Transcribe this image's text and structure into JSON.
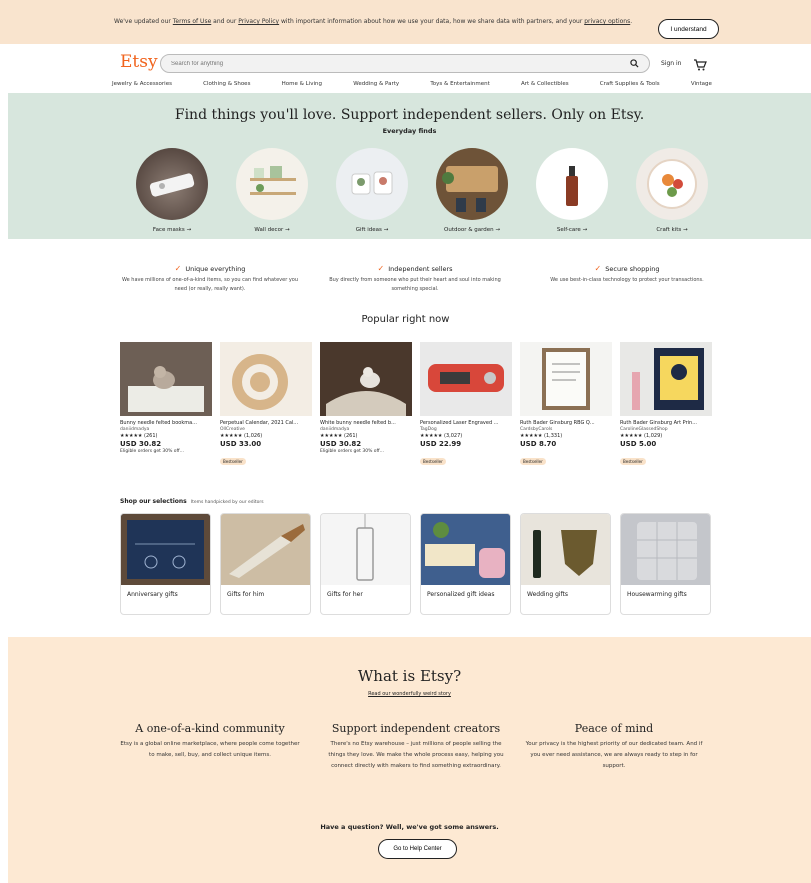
{
  "cookie": {
    "pre": "We've updated our ",
    "terms": "Terms of Use",
    "mid": " and our ",
    "privacy": "Privacy Policy",
    "post": " with important information about how we use your data, how we share data with partners, and your ",
    "options": "privacy options",
    "end": ".",
    "button": "I understand"
  },
  "header": {
    "logo": "Etsy",
    "search_placeholder": "Search for anything",
    "signin": "Sign in",
    "categories": [
      "Jewelry & Accessories",
      "Clothing & Shoes",
      "Home & Living",
      "Wedding & Party",
      "Toys & Entertainment",
      "Art & Collectibles",
      "Craft Supplies & Tools",
      "Vintage"
    ]
  },
  "hero": {
    "title": "Find things you'll love. Support independent sellers. Only on Etsy.",
    "subtitle": "Everyday finds",
    "items": [
      {
        "label": "Face masks →",
        "color": "#5a4b44"
      },
      {
        "label": "Wall decor →",
        "color": "#f4f1ea"
      },
      {
        "label": "Gift ideas →",
        "color": "#eceff2"
      },
      {
        "label": "Outdoor & garden →",
        "color": "#6e5338"
      },
      {
        "label": "Self-care →",
        "color": "#ffffff"
      },
      {
        "label": "Craft kits →",
        "color": "#f0ebe6"
      }
    ]
  },
  "props": [
    {
      "title": "Unique everything",
      "desc": "We have millions of one-of-a-kind items, so you can find whatever you need (or really, really want)."
    },
    {
      "title": "Independent sellers",
      "desc": "Buy directly from someone who put their heart and soul into making something special."
    },
    {
      "title": "Secure shopping",
      "desc": "We use best-in-class technology to protect your transactions."
    }
  ],
  "popular": {
    "title": "Popular right now",
    "items": [
      {
        "name": "Bunny needle felted bookma...",
        "shop": "daniidmadya",
        "rating": "★★★★★ (261)",
        "price": "USD 30.82",
        "note": "Eligible orders get 30% off...",
        "badge": ""
      },
      {
        "name": "Perpetual Calendar, 2021 Cal...",
        "shop": "OllCreative",
        "rating": "★★★★★ (1,026)",
        "price": "USD 33.00",
        "note": "",
        "badge": "Bestseller"
      },
      {
        "name": "White bunny needle felted b...",
        "shop": "daniidmadya",
        "rating": "★★★★★ (261)",
        "price": "USD 30.82",
        "note": "Eligible orders get 30% off...",
        "badge": ""
      },
      {
        "name": "Personalized Laser Engraved ...",
        "shop": "TagDog",
        "rating": "★★★★★ (3,027)",
        "price": "USD 22.99",
        "note": "",
        "badge": "Bestseller"
      },
      {
        "name": "Ruth Bader Ginsburg RBG Q...",
        "shop": "CardsbyCarols",
        "rating": "★★★★★ (1,331)",
        "price": "USD 8.70",
        "note": "",
        "badge": "Bestseller"
      },
      {
        "name": "Ruth Bader Ginsburg Art Prin...",
        "shop": "CarolineGlassedShop",
        "rating": "★★★★★ (1,029)",
        "price": "USD 5.00",
        "note": "",
        "badge": "Bestseller"
      }
    ]
  },
  "selections": {
    "title": "Shop our selections",
    "subtitle": "Items handpicked by our editors",
    "items": [
      {
        "label": "Anniversary gifts",
        "color": "#2a3b5c"
      },
      {
        "label": "Gifts for him",
        "color": "#d9cbb5"
      },
      {
        "label": "Gifts for her",
        "color": "#f5f5f5"
      },
      {
        "label": "Personalized gift ideas",
        "color": "#4d6fa8"
      },
      {
        "label": "Wedding gifts",
        "color": "#e8e4dc"
      },
      {
        "label": "Housewarming gifts",
        "color": "#c4c6cb"
      }
    ]
  },
  "what": {
    "title": "What is Etsy?",
    "link": "Read our wonderfully weird story",
    "cols": [
      {
        "title": "A one-of-a-kind community",
        "text": "Etsy is a global online marketplace, where people come together to make, sell, buy, and collect unique items."
      },
      {
        "title": "Support independent creators",
        "text": "There's no Etsy warehouse – just millions of people selling the things they love. We make the whole process easy, helping you connect directly with makers to find something extraordinary."
      },
      {
        "title": "Peace of mind",
        "text": "Your privacy is the highest priority of our dedicated team. And if you ever need assistance, we are always ready to step in for support."
      }
    ],
    "question": "Have a question? Well, we've got some answers.",
    "help_button": "Go to Help Center"
  },
  "colors": {
    "accent": "#f1641e",
    "hero_bg": "#d7e6dd",
    "banner_bg": "#f9e4ce",
    "what_bg": "#fde9d3"
  }
}
